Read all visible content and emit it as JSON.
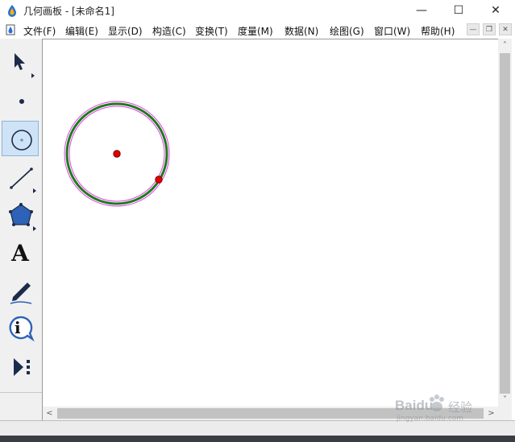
{
  "window": {
    "title": "几何画板 - [未命名1]",
    "minimize": "—",
    "maximize": "☐",
    "close": "✕"
  },
  "menu": [
    "文件(F)",
    "编辑(E)",
    "显示(D)",
    "构造(C)",
    "变换(T)",
    "度量(M)",
    "数据(N)",
    "绘图(G)",
    "窗口(W)",
    "帮助(H)"
  ],
  "mdi": {
    "minimize": "—",
    "restore": "❐",
    "close": "✕"
  },
  "tools": [
    {
      "name": "arrow-select",
      "selected": false
    },
    {
      "name": "point",
      "selected": false
    },
    {
      "name": "compass",
      "selected": true
    },
    {
      "name": "straightedge",
      "selected": false
    },
    {
      "name": "polygon",
      "selected": false
    },
    {
      "name": "text",
      "label": "A",
      "selected": false
    },
    {
      "name": "marker",
      "selected": false
    },
    {
      "name": "information",
      "label": "i",
      "selected": false
    },
    {
      "name": "custom-tools",
      "selected": false
    }
  ],
  "canvas": {
    "circle_color": "#1f7a1f",
    "selection_color": "#e040e0",
    "point_color": "#e00000"
  },
  "scrollbar": {
    "up": "˄",
    "down": "˅",
    "left": "<",
    "right": ">"
  },
  "watermark": {
    "brand": "Baidu",
    "brand_cn": "经验",
    "url": "jingyan.baidu.com"
  },
  "colors": {
    "selected_tool_bg": "#cfe3f6",
    "toolbox_bg": "#f0f0f0"
  }
}
